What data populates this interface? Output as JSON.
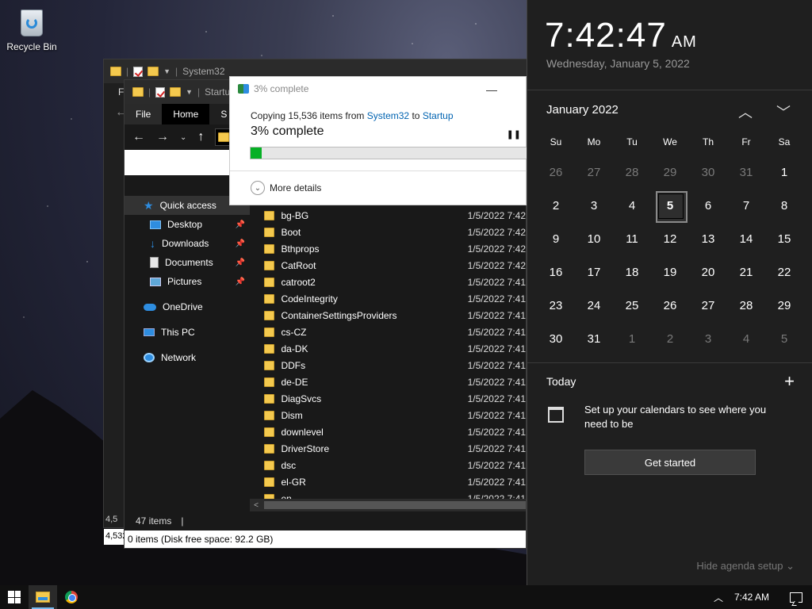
{
  "desktop": {
    "recycle_bin_label": "Recycle Bin"
  },
  "explorer_back": {
    "title": "System32",
    "side_letter": "F",
    "status_count": "4,5",
    "status_count2": "4,532"
  },
  "explorer_front": {
    "title": "Startup",
    "tabs": {
      "file": "File",
      "home": "Home",
      "share": "S"
    },
    "nav_pane": {
      "quick_access": "Quick access",
      "desktop": "Desktop",
      "downloads": "Downloads",
      "documents": "Documents",
      "pictures": "Pictures",
      "onedrive": "OneDrive",
      "this_pc": "This PC",
      "network": "Network"
    },
    "files": [
      {
        "name": "bg-BG",
        "date": "1/5/2022 7:42"
      },
      {
        "name": "Boot",
        "date": "1/5/2022 7:42"
      },
      {
        "name": "Bthprops",
        "date": "1/5/2022 7:42"
      },
      {
        "name": "CatRoot",
        "date": "1/5/2022 7:42"
      },
      {
        "name": "catroot2",
        "date": "1/5/2022 7:41"
      },
      {
        "name": "CodeIntegrity",
        "date": "1/5/2022 7:41"
      },
      {
        "name": "ContainerSettingsProviders",
        "date": "1/5/2022 7:41"
      },
      {
        "name": "cs-CZ",
        "date": "1/5/2022 7:41"
      },
      {
        "name": "da-DK",
        "date": "1/5/2022 7:41"
      },
      {
        "name": "DDFs",
        "date": "1/5/2022 7:41"
      },
      {
        "name": "de-DE",
        "date": "1/5/2022 7:41"
      },
      {
        "name": "DiagSvcs",
        "date": "1/5/2022 7:41"
      },
      {
        "name": "Dism",
        "date": "1/5/2022 7:41"
      },
      {
        "name": "downlevel",
        "date": "1/5/2022 7:41"
      },
      {
        "name": "DriverStore",
        "date": "1/5/2022 7:41"
      },
      {
        "name": "dsc",
        "date": "1/5/2022 7:41"
      },
      {
        "name": "el-GR",
        "date": "1/5/2022 7:41"
      },
      {
        "name": "en",
        "date": "1/5/2022 7:41"
      }
    ],
    "status_items": "47 items",
    "status_disk": "0 items (Disk free space: 92.2 GB)"
  },
  "copy_dialog": {
    "title": "3% complete",
    "copy_prefix": "Copying 15,536 items from",
    "source": "System32",
    "to_word": "to",
    "destination": "Startup",
    "percent_label": "3% complete",
    "progress": 0.04,
    "more_details": "More details"
  },
  "calendar": {
    "time": "7:42:47",
    "ampm": "AM",
    "date": "Wednesday, January 5, 2022",
    "month": "January 2022",
    "weekdays": [
      "Su",
      "Mo",
      "Tu",
      "We",
      "Th",
      "Fr",
      "Sa"
    ],
    "weeks": [
      [
        "26",
        "27",
        "28",
        "29",
        "30",
        "31",
        "1"
      ],
      [
        "2",
        "3",
        "4",
        "5",
        "6",
        "7",
        "8"
      ],
      [
        "9",
        "10",
        "11",
        "12",
        "13",
        "14",
        "15"
      ],
      [
        "16",
        "17",
        "18",
        "19",
        "20",
        "21",
        "22"
      ],
      [
        "23",
        "24",
        "25",
        "26",
        "27",
        "28",
        "29"
      ],
      [
        "30",
        "31",
        "1",
        "2",
        "3",
        "4",
        "5"
      ]
    ],
    "today": "5",
    "today_label": "Today",
    "setup_text": "Set up your calendars to see where you need to be",
    "get_started": "Get started",
    "hide_agenda": "Hide agenda setup"
  },
  "taskbar": {
    "time": "7:42 AM"
  },
  "colors": {
    "progress_green": "#06b025",
    "link_blue": "#0063b1",
    "flyout_bg": "#1f1f1f"
  }
}
